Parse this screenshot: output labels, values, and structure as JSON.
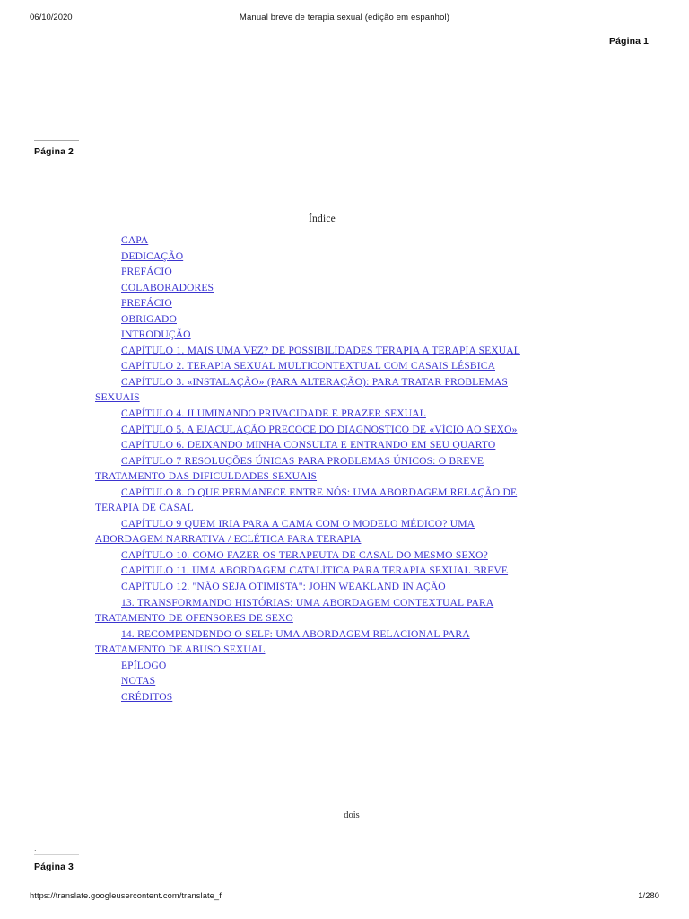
{
  "header": {
    "date": "06/10/2020",
    "title": "Manual breve de terapia sexual (edição em espanhol)"
  },
  "page_markers": {
    "page1_label": "Página 1",
    "page2_label": "Página 2",
    "page3_label": "Página 3",
    "stray_dot": "."
  },
  "toc": {
    "heading": "Índice",
    "link_color": "#3b34cf",
    "entries": [
      {
        "text": "CAPA"
      },
      {
        "text": "DEDICAÇÃO"
      },
      {
        "text": "PREFÁCIO"
      },
      {
        "text": "COLABORADORES"
      },
      {
        "text": "PREFÁCIO"
      },
      {
        "text": "OBRIGADO"
      },
      {
        "text": "INTRODUÇÃO"
      },
      {
        "text": "CAPÍTULO 1. MAIS UMA VEZ? DE POSSIBILIDADES TERAPIA A TERAPIA SEXUAL"
      },
      {
        "text": "CAPÍTULO 2. TERAPIA SEXUAL MULTICONTEXTUAL COM CASAIS LÉSBICA"
      },
      {
        "text": "CAPÍTULO 3. «INSTALAÇÃO» (PARA ALTERAÇÃO): PARA TRATAR PROBLEMAS SEXUAIS"
      },
      {
        "text": "CAPÍTULO 4. ILUMINANDO PRIVACIDADE E PRAZER SEXUAL"
      },
      {
        "text": "CAPÍTULO 5. A EJACULAÇÃO PRECOCE DO DIAGNOSTICO DE «VÍCIO AO SEXO»"
      },
      {
        "text": "CAPÍTULO 6. DEIXANDO MINHA CONSULTA E ENTRANDO EM SEU QUARTO"
      },
      {
        "text": "CAPÍTULO 7 RESOLUÇÕES ÚNICAS PARA PROBLEMAS ÚNICOS: O BREVE TRATAMENTO DAS DIFICULDADES SEXUAIS"
      },
      {
        "text": "CAPÍTULO 8. O QUE PERMANECE ENTRE NÓS: UMA ABORDAGEM RELAÇÃO DE TERAPIA DE CASAL"
      },
      {
        "text": "CAPÍTULO 9 QUEM IRIA PARA A CAMA COM O MODELO MÉDICO? UMA ABORDAGEM NARRATIVA / ECLÉTICA PARA TERAPIA"
      },
      {
        "text": "CAPÍTULO 10. COMO FAZER OS TERAPEUTA DE CASAL DO MESMO SEXO?"
      },
      {
        "text": "CAPÍTULO 11. UMA ABORDAGEM CATALÍTICA PARA TERAPIA SEXUAL BREVE"
      },
      {
        "text": "CAPÍTULO 12. \"NÃO SEJA OTIMISTA\": JOHN WEAKLAND IN AÇÃO"
      },
      {
        "text": "13. TRANSFORMANDO HISTÓRIAS: UMA ABORDAGEM CONTEXTUAL PARA TRATAMENTO DE OFENSORES DE SEXO"
      },
      {
        "text": "14. RECOMPENDENDO O SELF: UMA ABORDAGEM RELACIONAL PARA TRATAMENTO DE ABUSO SEXUAL"
      },
      {
        "text": "EPÍLOGO"
      },
      {
        "text": "NOTAS"
      },
      {
        "text": "CRÉDITOS"
      }
    ]
  },
  "folio": "dois",
  "footer": {
    "url": "https://translate.googleusercontent.com/translate_f",
    "count": "1/280"
  }
}
